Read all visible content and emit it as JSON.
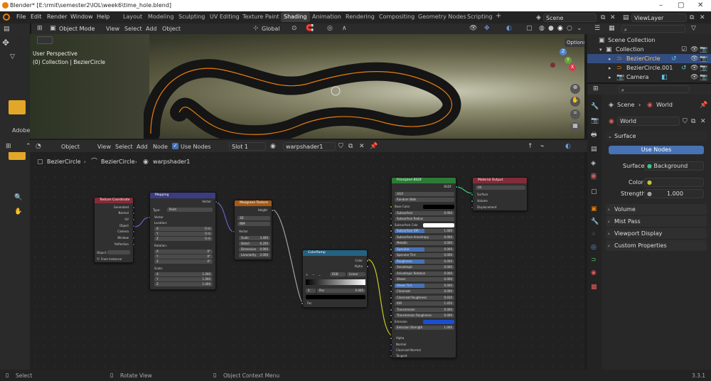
{
  "window": {
    "title": "Blender* [E:\\rmit\\semester2\\IOL\\week6\\time_hole.blend]",
    "controls": [
      "–",
      "▢",
      "✕"
    ]
  },
  "menu": [
    "File",
    "Edit",
    "Render",
    "Window",
    "Help"
  ],
  "workspaces": [
    "Layout",
    "Modeling",
    "Sculpting",
    "UV Editing",
    "Texture Paint",
    "Shading",
    "Animation",
    "Rendering",
    "Compositing",
    "Geometry Nodes",
    "Scripting",
    "+"
  ],
  "active_workspace": "Shading",
  "scene_field": "Scene",
  "viewlayer_field": "ViewLayer",
  "viewport_header": {
    "mode": "Object Mode",
    "menus": [
      "View",
      "Select",
      "Add",
      "Object"
    ],
    "transform": "Global",
    "options": "Options"
  },
  "viewport": {
    "perspective": "User Perspective",
    "collection": "(0) Collection | BezierCircle",
    "gizmo": {
      "x": "X",
      "y": "Y",
      "z": "Z"
    }
  },
  "node_header": {
    "type": "Object",
    "menus": [
      "View",
      "Select",
      "Add",
      "Node"
    ],
    "use_nodes": "Use Nodes",
    "slot": "Slot 1",
    "material": "warpshader1"
  },
  "breadcrumb": [
    "BezierCircle",
    "BezierCircle",
    "warpshader1"
  ],
  "nodes": {
    "texcoord": {
      "title": "Texture Coordinate",
      "outputs": [
        "Generated",
        "Normal",
        "UV",
        "Object",
        "Camera",
        "Window",
        "Reflection"
      ],
      "object_label": "Object:",
      "from_instancer": "From Instancer"
    },
    "mapping": {
      "title": "Mapping",
      "output": "Vector",
      "type_label": "Type:",
      "type_value": "Point",
      "vector": "Vector",
      "location": "Location:",
      "loc": [
        [
          "X",
          "0 m"
        ],
        [
          "Y",
          "0 m"
        ],
        [
          "Z",
          "0 m"
        ]
      ],
      "rotation": "Rotation:",
      "rot": [
        [
          "X",
          "0°"
        ],
        [
          "Y",
          "0°"
        ],
        [
          "Z",
          "0°"
        ]
      ],
      "scale": "Scale:",
      "scl": [
        [
          "X",
          "1.000"
        ],
        [
          "Y",
          "1.000"
        ],
        [
          "Z",
          "1.000"
        ]
      ]
    },
    "musgrave": {
      "title": "Musgrave Texture",
      "output": "Height",
      "dim": "3D",
      "type": "fBM",
      "vector": "Vector",
      "fields": [
        [
          "Scale",
          "3.400"
        ],
        [
          "Detail",
          "6.200"
        ],
        [
          "Dimension",
          "0.900"
        ],
        [
          "Lacunarity",
          "2.000"
        ]
      ]
    },
    "colorramp": {
      "title": "ColorRamp",
      "outputs": [
        "Color",
        "Alpha"
      ],
      "mode": "RGB",
      "interp": "Linear",
      "index": "0",
      "pos_label": "Pos",
      "pos_value": "0.000",
      "input": "Fac"
    },
    "bsdf": {
      "title": "Principled BSDF",
      "output": "BSDF",
      "dist": "GGX",
      "sss": "Random Walk",
      "rows": [
        [
          "Base Color",
          ""
        ],
        [
          "Subsurface",
          "0.000"
        ],
        [
          "Subsurface Radius",
          ""
        ],
        [
          "Subsurface Colo",
          ""
        ],
        [
          "Subsurface IOR",
          "1.400"
        ],
        [
          "Subsurface Anisotropy",
          "0.000"
        ],
        [
          "Metallic",
          "0.000"
        ],
        [
          "Specular",
          "0.000"
        ],
        [
          "Specular Tint",
          "0.000"
        ],
        [
          "Roughness",
          "0.000"
        ],
        [
          "Anisotropic",
          "0.000"
        ],
        [
          "Anisotropic Rotation",
          "0.000"
        ],
        [
          "Sheen",
          "0.000"
        ],
        [
          "Sheen Tint",
          "0.000"
        ],
        [
          "Clearcoat",
          "0.000"
        ],
        [
          "Clearcoat Roughness",
          "0.030"
        ],
        [
          "IOR",
          "1.450"
        ],
        [
          "Transmission",
          "0.000"
        ],
        [
          "Transmission Roughness",
          "0.000"
        ],
        [
          "Emission",
          ""
        ],
        [
          "Emission Strength",
          "1.000"
        ]
      ],
      "inputs": [
        "Alpha",
        "Normal",
        "Clearcoat Normal",
        "Tangent"
      ]
    },
    "output": {
      "title": "Material Output",
      "target": "All",
      "inputs": [
        "Surface",
        "Volume",
        "Displacement"
      ]
    }
  },
  "outliner": {
    "root": "Scene Collection",
    "collection": "Collection",
    "items": [
      "BezierCircle",
      "BezierCircle.001",
      "Camera"
    ]
  },
  "properties": {
    "scene": "Scene",
    "world": "World",
    "world_field": "World",
    "surface_panel": "Surface",
    "use_nodes": "Use Nodes",
    "surface_label": "Surface",
    "surface_value": "Background",
    "color_label": "Color",
    "strength_label": "Strength",
    "strength_value": "1.000",
    "panels": [
      "Volume",
      "Mist Pass",
      "Viewport Display",
      "Custom Properties"
    ]
  },
  "left_strip": {
    "label": "Adobe"
  },
  "status": {
    "select": "Select",
    "rotate": "Rotate View",
    "context": "Object Context Menu",
    "version": "3.3.1"
  },
  "colors": {
    "accent": "#4772b3",
    "orange": "#e87d0d",
    "selected_row": "#334d80"
  }
}
